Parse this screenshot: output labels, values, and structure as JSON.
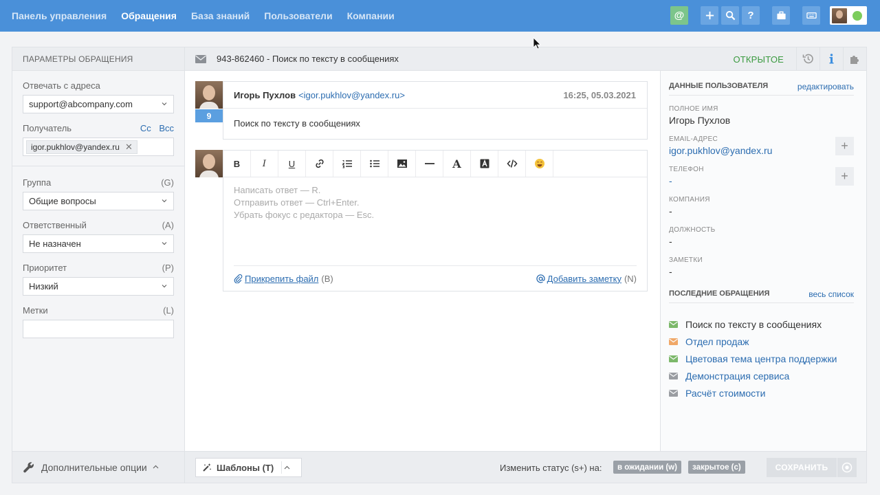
{
  "nav": {
    "items": [
      {
        "label": "Панель управления",
        "active": false
      },
      {
        "label": "Обращения",
        "active": true
      },
      {
        "label": "База знаний",
        "active": false
      },
      {
        "label": "Пользователи",
        "active": false
      },
      {
        "label": "Компании",
        "active": false
      }
    ],
    "icons": [
      "at-icon",
      "plus-icon",
      "search-icon",
      "help-icon",
      "briefcase-icon",
      "keyboard-icon"
    ],
    "help_glyph": "?",
    "at_glyph": "@"
  },
  "left": {
    "header": "ПАРАМЕТРЫ ОБРАЩЕНИЯ",
    "reply_from_label": "Отвечать с адреса",
    "reply_from_value": "support@abcompany.com",
    "recipient_label": "Получатель",
    "cc": "Cc",
    "bcc": "Bcc",
    "recipient_tag": "igor.pukhlov@yandex.ru",
    "tag_remove": "✕",
    "group_label": "Группа",
    "group_hint": "(G)",
    "group_value": "Общие вопросы",
    "assignee_label": "Ответственный",
    "assignee_hint": "(A)",
    "assignee_value": "Не назначен",
    "priority_label": "Приоритет",
    "priority_hint": "(P)",
    "priority_value": "Низкий",
    "tags_label": "Метки",
    "tags_hint": "(L)",
    "extra_options": "Дополнительные опции"
  },
  "ticket": {
    "title": "943-862460 - Поиск по тексту в сообщениях",
    "status": "ОТКРЫТОЕ"
  },
  "message": {
    "count": "9",
    "author": "Игорь Пухлов",
    "email": "<igor.pukhlov@yandex.ru>",
    "time": "16:25, 05.03.2021",
    "body": "Поиск по тексту в сообщениях"
  },
  "editor": {
    "tools": {
      "bold": "B",
      "italic": "I",
      "underline": "U",
      "font": "A"
    },
    "hint_1": "Написать ответ — R.",
    "hint_2": "Отправить ответ — Ctrl+Enter.",
    "hint_3": "Убрать фокус с редактора — Esc.",
    "attach_label": "Прикрепить файл",
    "attach_hint": "(B)",
    "note_label": "Добавить заметку",
    "note_hint": "(N)"
  },
  "footer": {
    "templates": "Шаблоны (T)",
    "change_status": "Изменить статус (s+) на:",
    "status_waiting": "в ожидании (w)",
    "status_closed": "закрытое (c)",
    "save": "СОХРАНИТЬ"
  },
  "user": {
    "header": "ДАННЫЕ ПОЛЬЗОВАТЕЛЯ",
    "edit": "редактировать",
    "fullname_label": "ПОЛНОЕ ИМЯ",
    "fullname": "Игорь Пухлов",
    "email_label": "EMAIL-АДРЕС",
    "email": "igor.pukhlov@yandex.ru",
    "phone_label": "ТЕЛЕФОН",
    "phone": "-",
    "company_label": "КОМПАНИЯ",
    "company": "-",
    "position_label": "ДОЛЖНОСТЬ",
    "position": "-",
    "notes_label": "ЗАМЕТКИ",
    "notes": "-",
    "plus": "+"
  },
  "recent": {
    "header": "ПОСЛЕДНИЕ ОБРАЩЕНИЯ",
    "all": "весь список",
    "items": [
      {
        "title": "Поиск по тексту в сообщениях",
        "color": "#7cb86a",
        "current": true
      },
      {
        "title": "Отдел продаж",
        "color": "#f0a868",
        "current": false
      },
      {
        "title": "Цветовая тема центра поддержки",
        "color": "#7cb86a",
        "current": false
      },
      {
        "title": "Демонстрация сервиса",
        "color": "#9a9da2",
        "current": false
      },
      {
        "title": "Расчёт стоимости",
        "color": "#9a9da2",
        "current": false
      }
    ]
  },
  "colors": {
    "topbar": "#4a90d9",
    "open_status": "#3a9a3f",
    "link": "#2b6cb0",
    "badge": "#5b9fe0"
  }
}
